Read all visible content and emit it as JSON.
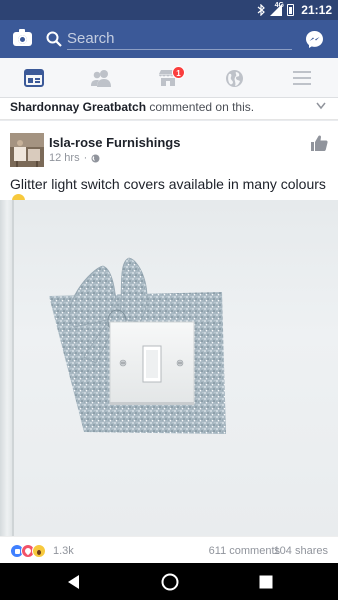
{
  "status_bar": {
    "network": "4G",
    "time": "21:12"
  },
  "top_bar": {
    "search_placeholder": "Search"
  },
  "nav": {
    "items": [
      {
        "name": "news-feed"
      },
      {
        "name": "friends"
      },
      {
        "name": "marketplace",
        "badge": "1"
      },
      {
        "name": "notifications"
      },
      {
        "name": "menu"
      }
    ]
  },
  "activity": {
    "actor": "Shardonnay Greatbatch",
    "action": "commented on this."
  },
  "post": {
    "page_name": "Isla-rose Furnishings",
    "time": "12 hrs",
    "text": "Glitter light switch covers available in many colours",
    "reactions_count": "1.3k",
    "comments": "611 comments",
    "shares": "104 shares"
  },
  "colors": {
    "brand": "#3b5998",
    "status_bar": "#2d4373",
    "badge": "#fa3e3e"
  }
}
